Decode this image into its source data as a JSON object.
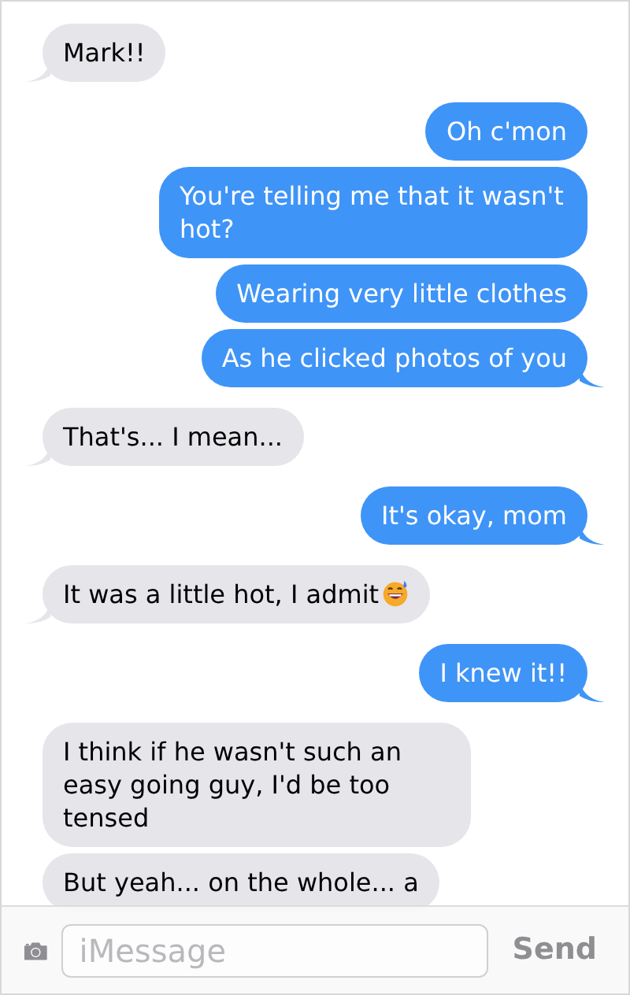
{
  "messages": [
    {
      "kind": "received",
      "text": "Mark!!",
      "tail": true
    },
    {
      "kind": "sent",
      "text": "Oh c'mon",
      "tail": false
    },
    {
      "kind": "sent",
      "text": "You're telling me that it wasn't hot?",
      "tail": false
    },
    {
      "kind": "sent",
      "text": "Wearing very little clothes",
      "tail": false
    },
    {
      "kind": "sent",
      "text": "As he clicked photos of you",
      "tail": true
    },
    {
      "kind": "received",
      "text": "That's... I mean...",
      "tail": true
    },
    {
      "kind": "sent",
      "text": "It's okay, mom",
      "tail": true
    },
    {
      "kind": "received",
      "text": "It was a little hot, I admit",
      "tail": true,
      "emoji": true
    },
    {
      "kind": "sent",
      "text": "I knew it!!",
      "tail": true
    },
    {
      "kind": "received",
      "text": "I think if he wasn't such an easy going guy, I'd be too tensed",
      "tail": false
    },
    {
      "kind": "received",
      "text": "But yeah... on the whole... a",
      "tail": false
    }
  ],
  "composer": {
    "placeholder": "iMessage",
    "send_label": "Send"
  }
}
